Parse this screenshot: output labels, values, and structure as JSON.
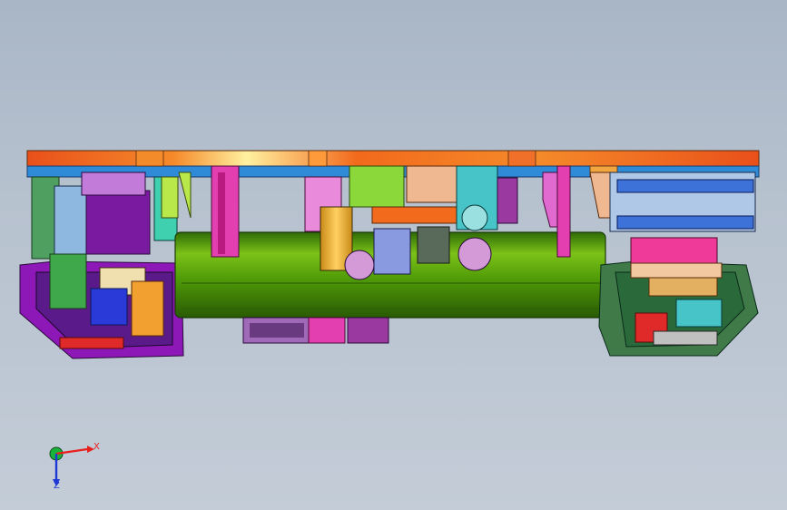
{
  "axes": {
    "x_label": "X",
    "z_label": "Z",
    "x_color": "#e8201c",
    "z_color": "#1e38d8",
    "origin_color": "#19b43a"
  },
  "view": {
    "background_top": "#a9b6c6",
    "background_bottom": "#c3ccd7"
  },
  "parts": {
    "top_plate": "#f26a1c",
    "tube": "#4f9a08",
    "chassis_left": "#8e17b8",
    "chassis_right": "#3f7a48",
    "accent_magenta": "#e43fb0",
    "accent_cyan": "#4fd0d0",
    "accent_blue": "#3d73d8"
  }
}
